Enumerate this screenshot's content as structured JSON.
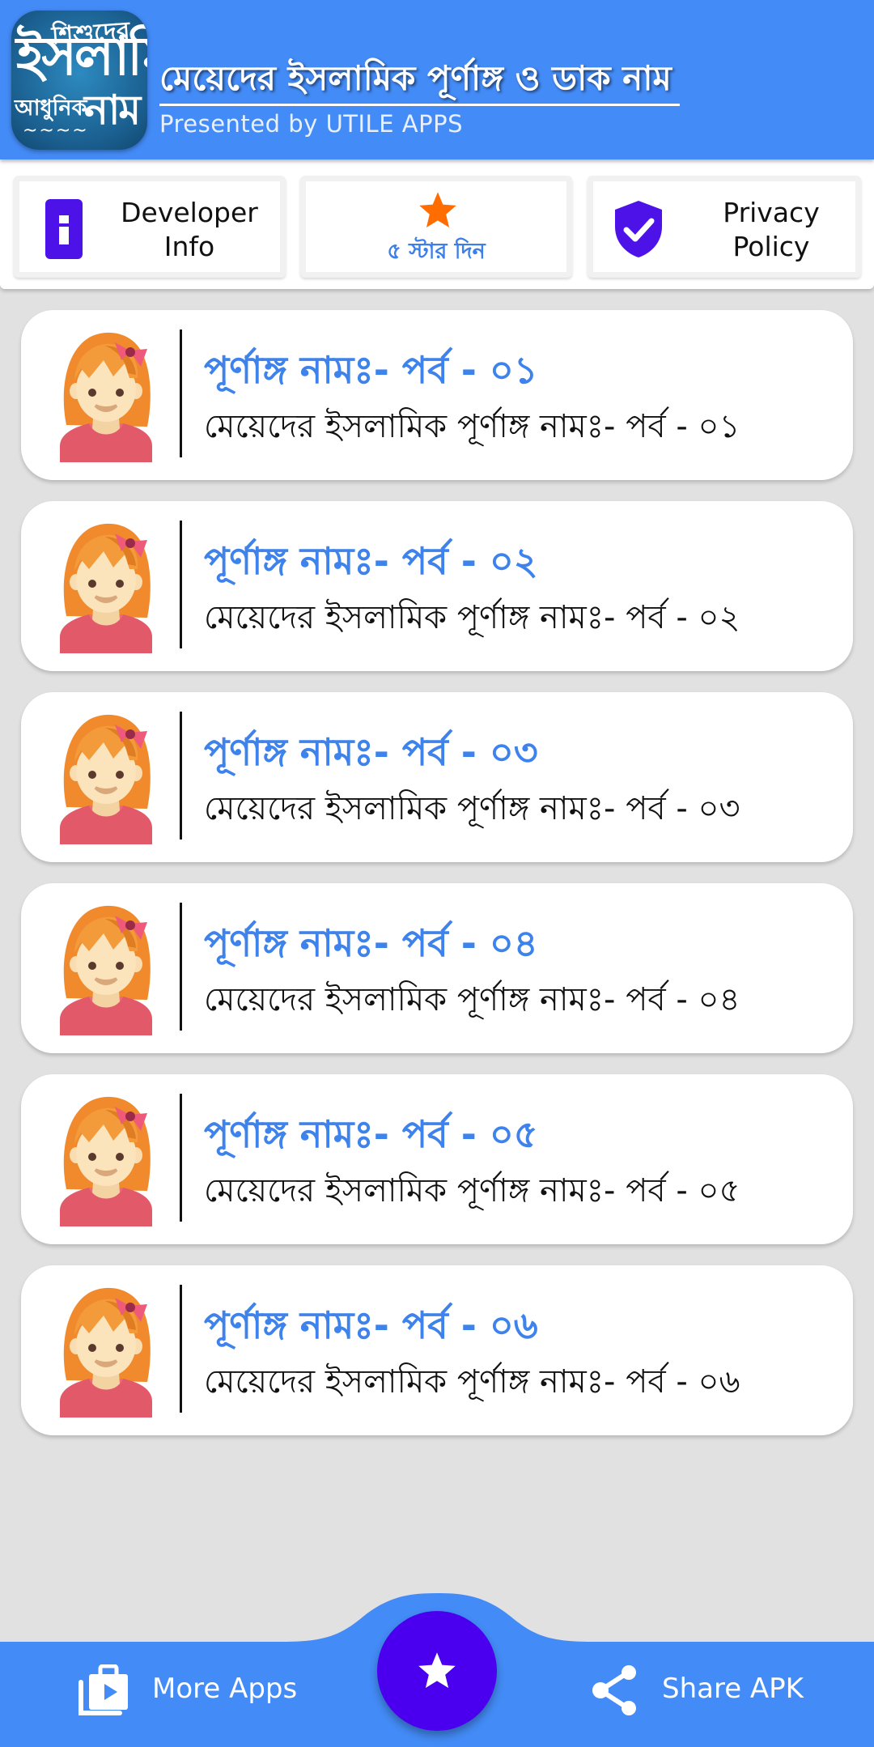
{
  "header": {
    "logo": {
      "line1": "শিশুদের",
      "line2": "ইসলামি",
      "line3": "আধুনিক",
      "line4": "নাম",
      "line5": "~~~~"
    },
    "title": "মেয়েদের ইসলামিক পূর্ণাঙ্গ ও ডাক নাম",
    "subtitle": "Presented by UTILE APPS"
  },
  "actions": {
    "developer": {
      "line1": "Developer",
      "line2": "Info",
      "icon": "info-icon"
    },
    "rate": {
      "label": "৫ স্টার দিন",
      "icon": "star-icon"
    },
    "privacy": {
      "line1": "Privacy",
      "line2": "Policy",
      "icon": "shield-check-icon"
    }
  },
  "cards": [
    {
      "title": "পূর্ণাঙ্গ নামঃ- পর্ব - ০১",
      "subtitle": "মেয়েদের ইসলামিক পূর্ণাঙ্গ নামঃ- পর্ব - ০১"
    },
    {
      "title": "পূর্ণাঙ্গ নামঃ- পর্ব - ০২",
      "subtitle": "মেয়েদের ইসলামিক পূর্ণাঙ্গ নামঃ- পর্ব - ০২"
    },
    {
      "title": "পূর্ণাঙ্গ নামঃ- পর্ব - ০৩",
      "subtitle": "মেয়েদের ইসলামিক পূর্ণাঙ্গ নামঃ- পর্ব - ০৩"
    },
    {
      "title": "পূর্ণাঙ্গ নামঃ- পর্ব - ০৪",
      "subtitle": "মেয়েদের ইসলামিক পূর্ণাঙ্গ নামঃ- পর্ব - ০৪"
    },
    {
      "title": "পূর্ণাঙ্গ নামঃ- পর্ব - ০৫",
      "subtitle": "মেয়েদের ইসলামিক পূর্ণাঙ্গ নামঃ- পর্ব - ০৫"
    },
    {
      "title": "পূর্ণাঙ্গ নামঃ- পর্ব - ০৬",
      "subtitle": "মেয়েদের ইসলামিক পূর্ণাঙ্গ নামঃ- পর্ব - ০৬"
    }
  ],
  "bottom_nav": {
    "more_apps": {
      "label": "More Apps",
      "icon": "store-bag-icon"
    },
    "fab": {
      "icon": "star-icon"
    },
    "share": {
      "label": "Share APK",
      "icon": "share-icon"
    }
  },
  "colors": {
    "primary": "#438bf6",
    "accent": "#4a00ee",
    "title_blue": "#3e82ec",
    "star_orange": "#ff6d00",
    "background": "#e1e1e1"
  }
}
